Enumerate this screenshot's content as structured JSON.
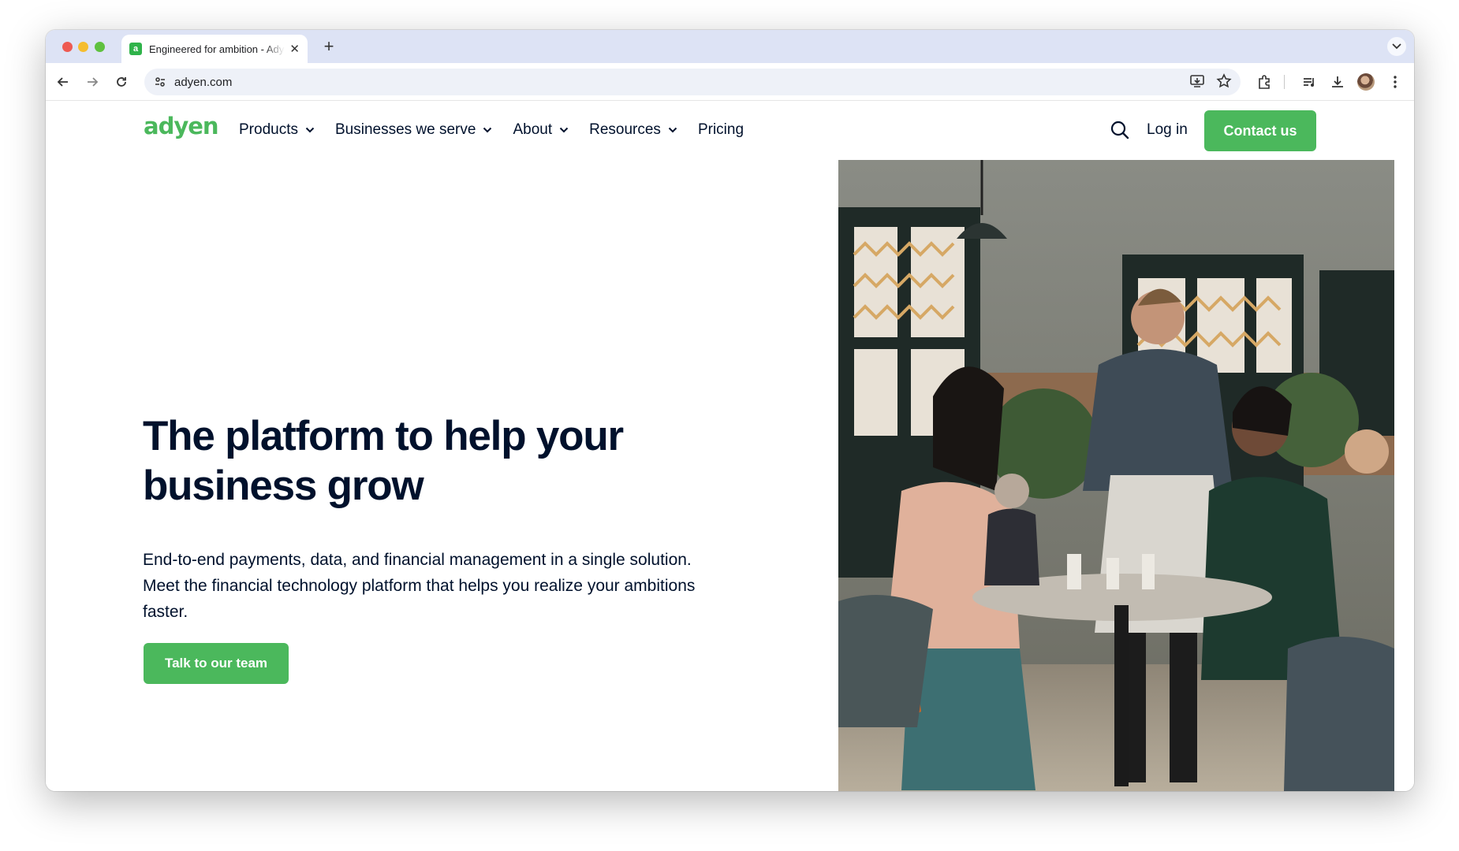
{
  "browser": {
    "tab_title": "Engineered for ambition - Adyen",
    "tab_favicon_letter": "a",
    "url": "adyen.com"
  },
  "site": {
    "logo_text": "adyen",
    "nav": [
      {
        "label": "Products",
        "has_dropdown": true
      },
      {
        "label": "Businesses we serve",
        "has_dropdown": true
      },
      {
        "label": "About",
        "has_dropdown": true
      },
      {
        "label": "Resources",
        "has_dropdown": true
      },
      {
        "label": "Pricing",
        "has_dropdown": false
      }
    ],
    "login_label": "Log in",
    "contact_label": "Contact us"
  },
  "hero": {
    "title": "The platform to help your business grow",
    "subtitle": "End-to-end payments, data, and financial management in a single solution. Meet the financial technology platform that helps you realize your ambitions faster.",
    "cta_label": "Talk to our team"
  },
  "colors": {
    "brand_green": "#4bb85c",
    "text_dark": "#00112c"
  }
}
